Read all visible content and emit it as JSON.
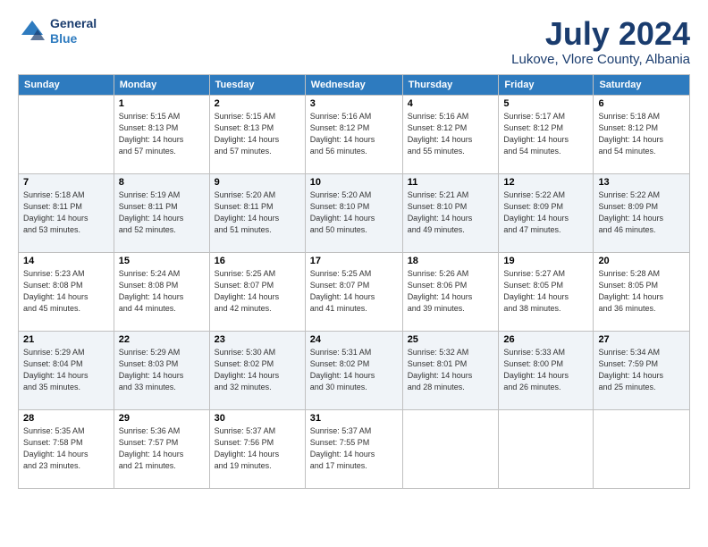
{
  "header": {
    "logo": {
      "general": "General",
      "blue": "Blue"
    },
    "title": "July 2024",
    "location": "Lukove, Vlore County, Albania"
  },
  "calendar": {
    "headers": [
      "Sunday",
      "Monday",
      "Tuesday",
      "Wednesday",
      "Thursday",
      "Friday",
      "Saturday"
    ],
    "weeks": [
      {
        "days": [
          {
            "num": "",
            "info": ""
          },
          {
            "num": "1",
            "info": "Sunrise: 5:15 AM\nSunset: 8:13 PM\nDaylight: 14 hours\nand 57 minutes."
          },
          {
            "num": "2",
            "info": "Sunrise: 5:15 AM\nSunset: 8:13 PM\nDaylight: 14 hours\nand 57 minutes."
          },
          {
            "num": "3",
            "info": "Sunrise: 5:16 AM\nSunset: 8:12 PM\nDaylight: 14 hours\nand 56 minutes."
          },
          {
            "num": "4",
            "info": "Sunrise: 5:16 AM\nSunset: 8:12 PM\nDaylight: 14 hours\nand 55 minutes."
          },
          {
            "num": "5",
            "info": "Sunrise: 5:17 AM\nSunset: 8:12 PM\nDaylight: 14 hours\nand 54 minutes."
          },
          {
            "num": "6",
            "info": "Sunrise: 5:18 AM\nSunset: 8:12 PM\nDaylight: 14 hours\nand 54 minutes."
          }
        ]
      },
      {
        "days": [
          {
            "num": "7",
            "info": "Sunrise: 5:18 AM\nSunset: 8:11 PM\nDaylight: 14 hours\nand 53 minutes."
          },
          {
            "num": "8",
            "info": "Sunrise: 5:19 AM\nSunset: 8:11 PM\nDaylight: 14 hours\nand 52 minutes."
          },
          {
            "num": "9",
            "info": "Sunrise: 5:20 AM\nSunset: 8:11 PM\nDaylight: 14 hours\nand 51 minutes."
          },
          {
            "num": "10",
            "info": "Sunrise: 5:20 AM\nSunset: 8:10 PM\nDaylight: 14 hours\nand 50 minutes."
          },
          {
            "num": "11",
            "info": "Sunrise: 5:21 AM\nSunset: 8:10 PM\nDaylight: 14 hours\nand 49 minutes."
          },
          {
            "num": "12",
            "info": "Sunrise: 5:22 AM\nSunset: 8:09 PM\nDaylight: 14 hours\nand 47 minutes."
          },
          {
            "num": "13",
            "info": "Sunrise: 5:22 AM\nSunset: 8:09 PM\nDaylight: 14 hours\nand 46 minutes."
          }
        ]
      },
      {
        "days": [
          {
            "num": "14",
            "info": "Sunrise: 5:23 AM\nSunset: 8:08 PM\nDaylight: 14 hours\nand 45 minutes."
          },
          {
            "num": "15",
            "info": "Sunrise: 5:24 AM\nSunset: 8:08 PM\nDaylight: 14 hours\nand 44 minutes."
          },
          {
            "num": "16",
            "info": "Sunrise: 5:25 AM\nSunset: 8:07 PM\nDaylight: 14 hours\nand 42 minutes."
          },
          {
            "num": "17",
            "info": "Sunrise: 5:25 AM\nSunset: 8:07 PM\nDaylight: 14 hours\nand 41 minutes."
          },
          {
            "num": "18",
            "info": "Sunrise: 5:26 AM\nSunset: 8:06 PM\nDaylight: 14 hours\nand 39 minutes."
          },
          {
            "num": "19",
            "info": "Sunrise: 5:27 AM\nSunset: 8:05 PM\nDaylight: 14 hours\nand 38 minutes."
          },
          {
            "num": "20",
            "info": "Sunrise: 5:28 AM\nSunset: 8:05 PM\nDaylight: 14 hours\nand 36 minutes."
          }
        ]
      },
      {
        "days": [
          {
            "num": "21",
            "info": "Sunrise: 5:29 AM\nSunset: 8:04 PM\nDaylight: 14 hours\nand 35 minutes."
          },
          {
            "num": "22",
            "info": "Sunrise: 5:29 AM\nSunset: 8:03 PM\nDaylight: 14 hours\nand 33 minutes."
          },
          {
            "num": "23",
            "info": "Sunrise: 5:30 AM\nSunset: 8:02 PM\nDaylight: 14 hours\nand 32 minutes."
          },
          {
            "num": "24",
            "info": "Sunrise: 5:31 AM\nSunset: 8:02 PM\nDaylight: 14 hours\nand 30 minutes."
          },
          {
            "num": "25",
            "info": "Sunrise: 5:32 AM\nSunset: 8:01 PM\nDaylight: 14 hours\nand 28 minutes."
          },
          {
            "num": "26",
            "info": "Sunrise: 5:33 AM\nSunset: 8:00 PM\nDaylight: 14 hours\nand 26 minutes."
          },
          {
            "num": "27",
            "info": "Sunrise: 5:34 AM\nSunset: 7:59 PM\nDaylight: 14 hours\nand 25 minutes."
          }
        ]
      },
      {
        "days": [
          {
            "num": "28",
            "info": "Sunrise: 5:35 AM\nSunset: 7:58 PM\nDaylight: 14 hours\nand 23 minutes."
          },
          {
            "num": "29",
            "info": "Sunrise: 5:36 AM\nSunset: 7:57 PM\nDaylight: 14 hours\nand 21 minutes."
          },
          {
            "num": "30",
            "info": "Sunrise: 5:37 AM\nSunset: 7:56 PM\nDaylight: 14 hours\nand 19 minutes."
          },
          {
            "num": "31",
            "info": "Sunrise: 5:37 AM\nSunset: 7:55 PM\nDaylight: 14 hours\nand 17 minutes."
          },
          {
            "num": "",
            "info": ""
          },
          {
            "num": "",
            "info": ""
          },
          {
            "num": "",
            "info": ""
          }
        ]
      }
    ]
  }
}
